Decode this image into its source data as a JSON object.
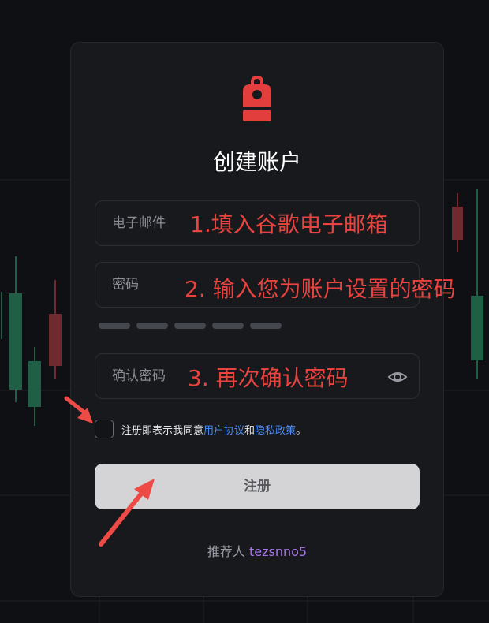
{
  "colors": {
    "accent_red": "#e33e3e",
    "link_blue": "#4b8df8",
    "referral_purple": "#a876e8",
    "annotation_red": "#e8433f",
    "candle_green": "#1f5f46",
    "candle_red": "#6e2a2e"
  },
  "logo_icon": "backpack-icon",
  "form": {
    "title": "创建账户",
    "email_placeholder": "电子邮件",
    "password_placeholder": "密码",
    "confirm_placeholder": "确认密码",
    "agree_prefix": "注册即表示我同意",
    "terms_link": "用户协议",
    "and_text": "和",
    "privacy_link": "隐私政策",
    "agree_suffix": "。",
    "submit_label": "注册",
    "referrer_label": "推荐人",
    "referrer_code": "tezsnno5"
  },
  "annotations": {
    "step1": "1.填入谷歌电子邮箱",
    "step2": "2. 输入您为账户设置的密码",
    "step3": "3. 再次确认密码"
  }
}
